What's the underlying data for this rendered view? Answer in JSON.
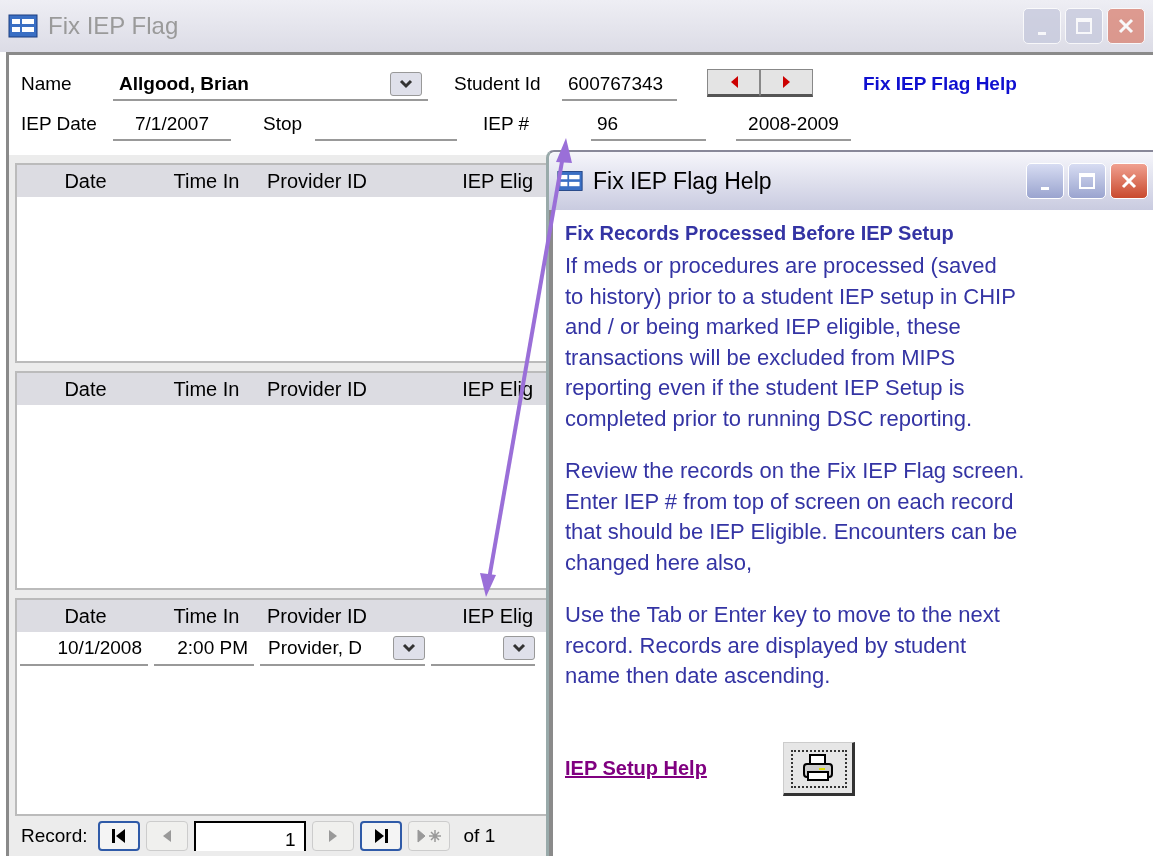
{
  "main_window": {
    "title": "Fix IEP Flag",
    "active": false
  },
  "form": {
    "name_label": "Name",
    "name_value": "Allgood, Brian",
    "student_id_label": "Student Id",
    "student_id": "600767343",
    "help_link": "Fix IEP Flag Help",
    "iep_date_label": "IEP Date",
    "iep_date": "7/1/2007",
    "stop_label": "Stop",
    "iep_number_label": "IEP #",
    "iep_number": "96",
    "school_year": "2008-2009"
  },
  "subforms": [
    {
      "columns": [
        "Date",
        "Time In",
        "Provider ID",
        "IEP Elig"
      ]
    },
    {
      "columns": [
        "Date",
        "Time In",
        "Provider ID",
        "IEP Elig"
      ]
    },
    {
      "columns": [
        "Date",
        "Time In",
        "Provider ID",
        "IEP Elig"
      ],
      "rows": [
        {
          "date": "10/1/2008",
          "time_in": "2:00 PM",
          "provider_id": "Provider, D"
        }
      ]
    }
  ],
  "record_nav": {
    "label": "Record:",
    "current": "1",
    "of_label": "of",
    "total": "1",
    "buttons": [
      {
        "kind": "first",
        "disabled": false
      },
      {
        "kind": "prev",
        "disabled": true
      },
      {
        "kind": "next",
        "disabled": true
      },
      {
        "kind": "last",
        "disabled": false
      },
      {
        "kind": "new",
        "disabled": true
      }
    ]
  },
  "help_window": {
    "title": "Fix IEP Flag Help",
    "active": true,
    "heading": "Fix Records Processed Before IEP Setup",
    "paragraphs": [
      {
        "lines": [
          "If meds or procedures are processed (saved",
          "to history) prior to a student IEP setup in CHIP",
          "and / or being marked IEP eligible, these",
          "transactions will be excluded from MIPS",
          "reporting even if the student IEP Setup is",
          "completed prior to running DSC reporting."
        ]
      },
      {
        "lines": [
          "Review the records on the Fix IEP Flag screen.",
          "Enter IEP # from top of screen on each record",
          "that should be IEP Eligible. Encounters can be",
          "changed here also,"
        ]
      },
      {
        "lines": [
          "Use the Tab or Enter key to move to the next",
          "record. Records are displayed by student",
          "name then date ascending."
        ]
      }
    ],
    "link": "IEP Setup Help"
  }
}
